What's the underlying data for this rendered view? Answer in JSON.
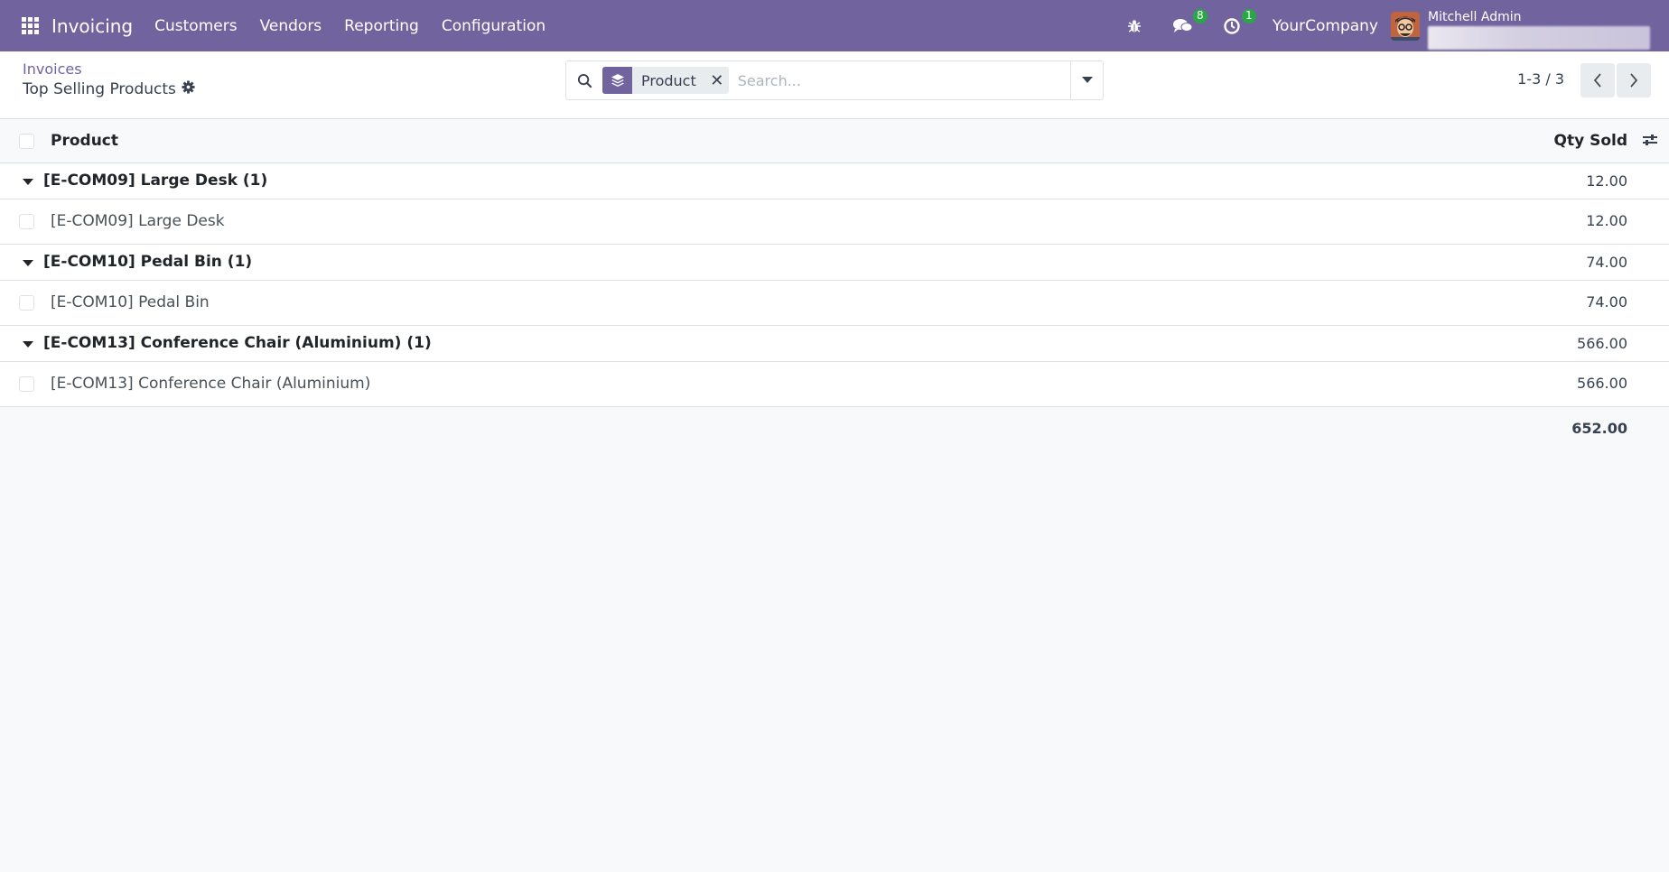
{
  "navbar": {
    "app_name": "Invoicing",
    "menu": [
      "Customers",
      "Vendors",
      "Reporting",
      "Configuration"
    ],
    "messages_badge": "8",
    "activities_badge": "1",
    "company": "YourCompany",
    "user_name": "Mitchell Admin",
    "bg_color": "#71639e"
  },
  "control_panel": {
    "breadcrumb": "Invoices",
    "view_title": "Top Selling Products",
    "search": {
      "facet_label": "Product",
      "placeholder": "Search..."
    },
    "pager": "1-3 / 3"
  },
  "list": {
    "columns": {
      "product": "Product",
      "qty": "Qty Sold"
    },
    "groups": [
      {
        "label": "[E-COM09] Large Desk (1)",
        "qty": "12.00",
        "rows": [
          {
            "product": "[E-COM09] Large Desk",
            "qty": "12.00"
          }
        ]
      },
      {
        "label": "[E-COM10] Pedal Bin (1)",
        "qty": "74.00",
        "rows": [
          {
            "product": "[E-COM10] Pedal Bin",
            "qty": "74.00"
          }
        ]
      },
      {
        "label": "[E-COM13] Conference Chair (Aluminium) (1)",
        "qty": "566.00",
        "rows": [
          {
            "product": "[E-COM13] Conference Chair (Aluminium)",
            "qty": "566.00"
          }
        ]
      }
    ],
    "total": "652.00"
  }
}
